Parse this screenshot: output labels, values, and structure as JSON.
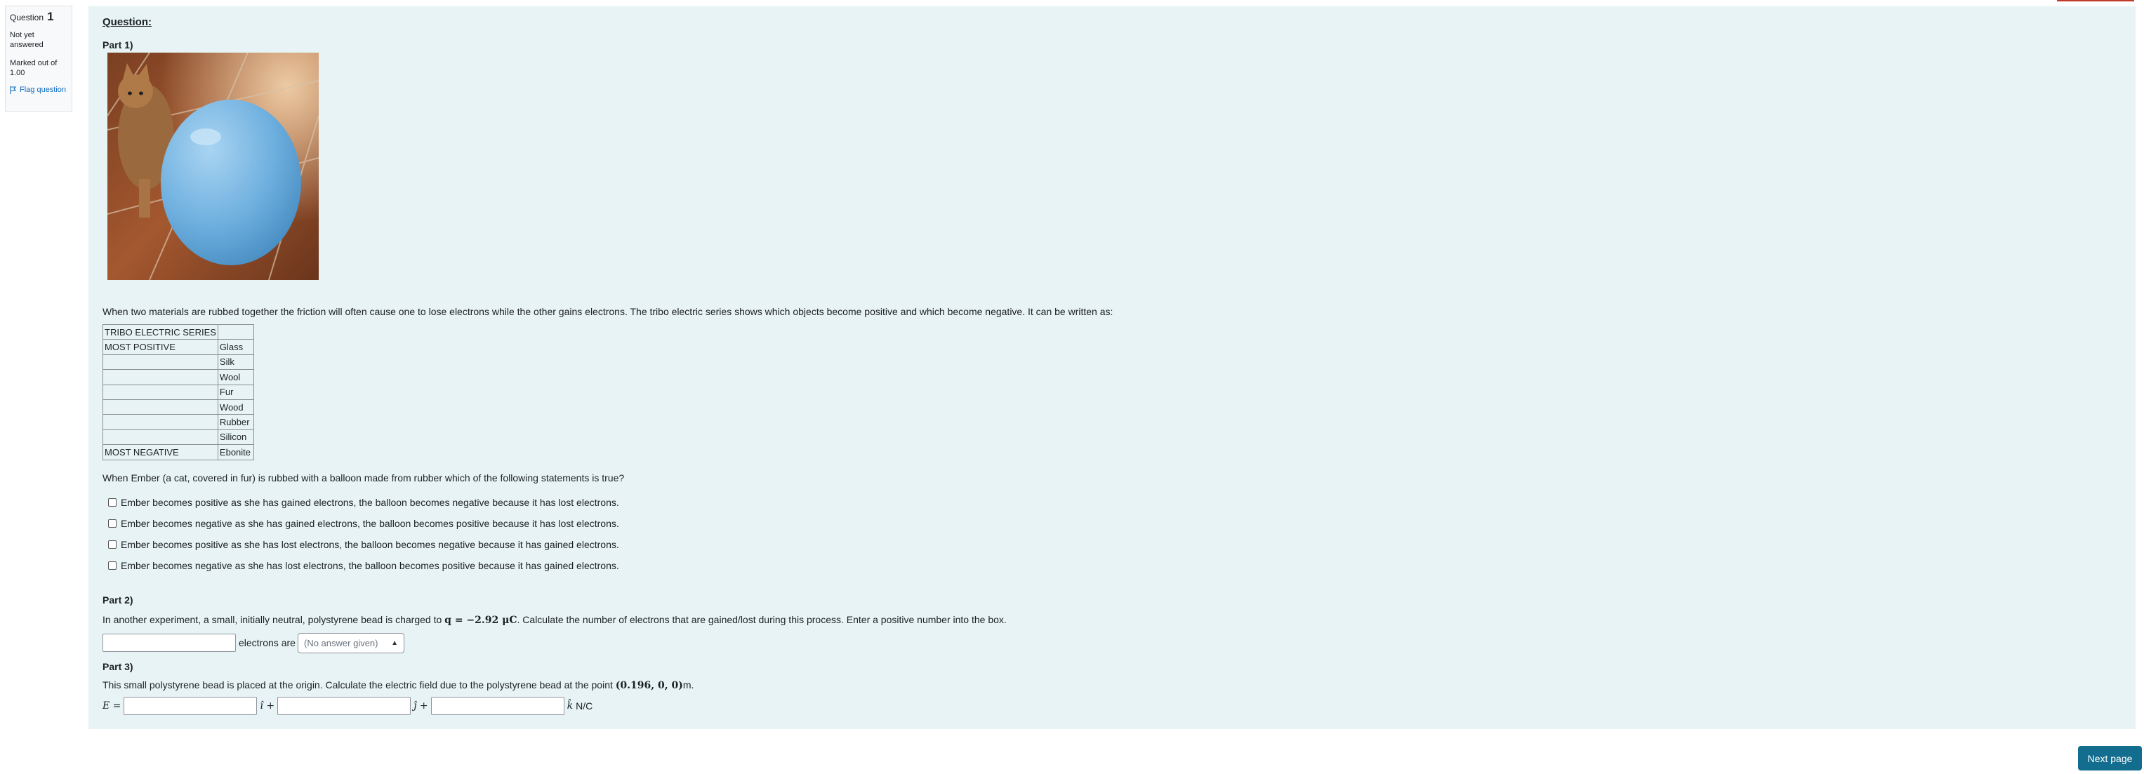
{
  "question_info": {
    "label": "Question",
    "number": "1",
    "state": "Not yet answered",
    "grade": "Marked out of 1.00",
    "flag_label": "Flag question"
  },
  "question": {
    "heading": "Question:",
    "part1": {
      "label": "Part 1)",
      "intro": "When two materials are rubbed together the friction will often cause one to lose electrons while the other gains electrons. The tribo electric series shows which objects become positive and which become negative. It can be written as:",
      "table": [
        [
          "TRIBO ELECTRIC SERIES",
          ""
        ],
        [
          "MOST POSITIVE",
          "Glass"
        ],
        [
          "",
          "Silk"
        ],
        [
          "",
          "Wool"
        ],
        [
          "",
          "Fur"
        ],
        [
          "",
          "Wood"
        ],
        [
          "",
          "Rubber"
        ],
        [
          "",
          "Silicon"
        ],
        [
          "MOST NEGATIVE",
          "Ebonite"
        ]
      ],
      "prompt": "When Ember (a cat, covered in fur) is rubbed with a balloon made from rubber which of the following statements is true?",
      "options": [
        "Ember becomes positive as she has gained electrons, the balloon becomes negative because it has lost electrons.",
        "Ember becomes negative as she has gained electrons, the balloon becomes positive because it has lost electrons.",
        "Ember becomes positive as she has lost electrons, the balloon becomes negative because it has gained electrons.",
        "Ember becomes negative as she has lost electrons, the balloon becomes positive because it has gained electrons."
      ]
    },
    "part2": {
      "label": "Part 2)",
      "text_before": "In another experiment, a small, initially neutral, polystyrene bead is charged to ",
      "charge_expr": "q = −2.92 μC",
      "text_after": ". Calculate the number of electrons that are gained/lost during this process. Enter a positive number into the box.",
      "electrons_label": "electrons are",
      "select_value": "(No answer given)"
    },
    "part3": {
      "label": "Part 3)",
      "text_before": "This small polystyrene bead is placed at the origin. Calculate the electric field due to the polystyrene bead at the point ",
      "point_expr": "(0.196, 0, 0)",
      "text_after": "m.",
      "e_label": "E =",
      "i_hat": "î +",
      "j_hat": "ĵ +",
      "k_hat": "k̂",
      "unit": "N/C"
    }
  },
  "footer": {
    "next_label": "Next page"
  }
}
